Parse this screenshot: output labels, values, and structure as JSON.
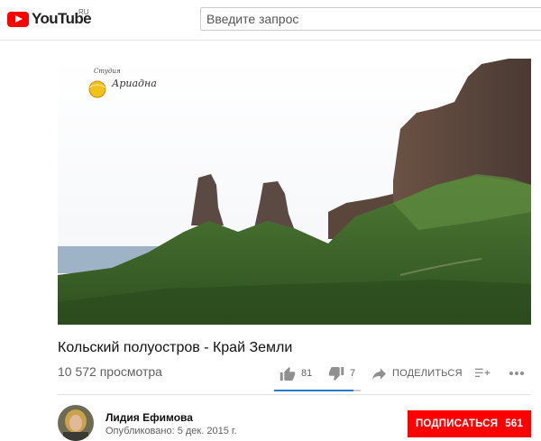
{
  "header": {
    "logo_text": "YouTube",
    "logo_region": "RU",
    "search_placeholder": "Введите запрос"
  },
  "video": {
    "watermark_small": "Студия",
    "watermark_name": "Ариадна",
    "title": "Кольский полуостров - Край Земли",
    "views": "10 572 просмотра"
  },
  "actions": {
    "likes": "81",
    "dislikes": "7",
    "share_label": "ПОДЕЛИТЬСЯ",
    "like_ratio": 0.92
  },
  "channel": {
    "name": "Лидия Ефимова",
    "published": "Опубликовано: 5 дек. 2015 г."
  },
  "subscribe": {
    "label": "ПОДПИСАТЬСЯ",
    "count": "561"
  },
  "colors": {
    "brand_red": "#ff0000",
    "like_bar": "#2b79c9"
  },
  "icons": [
    "youtube-logo-icon",
    "thumb-up-icon",
    "thumb-down-icon",
    "share-arrow-icon",
    "add-to-playlist-icon",
    "more-icon"
  ]
}
